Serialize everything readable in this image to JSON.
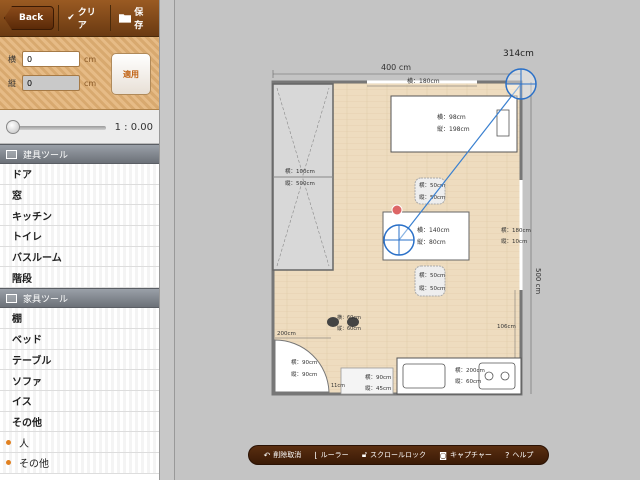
{
  "topbar": {
    "back": "Back",
    "clear": "クリア",
    "save": "保存"
  },
  "size_inputs": {
    "width_label": "横",
    "width_value": "0",
    "depth_label": "縦",
    "depth_value": "0",
    "unit": "cm",
    "apply": "適用"
  },
  "rotation": {
    "value": "1 : 0.00",
    "level": 0
  },
  "fixture_tools": {
    "title": "建具ツール",
    "items": [
      "ドア",
      "窓",
      "キッチン",
      "トイレ",
      "バスルーム",
      "階段"
    ]
  },
  "furniture_tools": {
    "title": "家具ツール",
    "items": [
      "棚",
      "ベッド",
      "テーブル",
      "ソファ",
      "イス",
      "その他"
    ],
    "extra_items": [
      "人",
      "その他"
    ]
  },
  "floorplan": {
    "ruler_label": "314cm",
    "room_width": "400 cm",
    "room_height": "500 cm",
    "window_top": "横：180cm",
    "bed": {
      "w": "横：98cm",
      "h": "縦：198cm"
    },
    "closet": {
      "w": "横：100cm",
      "h": "縦：500cm"
    },
    "chair_top": {
      "w": "横：50cm",
      "h": "縦：50cm"
    },
    "table": {
      "w": "横：140cm",
      "h": "縦：80cm"
    },
    "chair_bottom": {
      "w": "横：50cm",
      "h": "縦：50cm"
    },
    "right_window": {
      "w": "横：180cm",
      "h": "縦：10cm"
    },
    "small_chairs": {
      "w": "横：60cm",
      "h": "縦：60cm"
    },
    "dim_200": "200cm",
    "dim_106": "106cm",
    "door": {
      "w": "横：90cm",
      "h": "縦：90cm"
    },
    "cabinet": {
      "w": "横：90cm",
      "h": "縦：45cm"
    },
    "dim_11": "11cm",
    "kitchen": {
      "w": "横：200cm",
      "h": "縦：60cm"
    }
  },
  "bottom_toolbar": {
    "undo": "削除取消",
    "ruler": "ルーラー",
    "scroll_lock": "スクロールロック",
    "capture": "キャプチャー",
    "help": "ヘルプ"
  }
}
